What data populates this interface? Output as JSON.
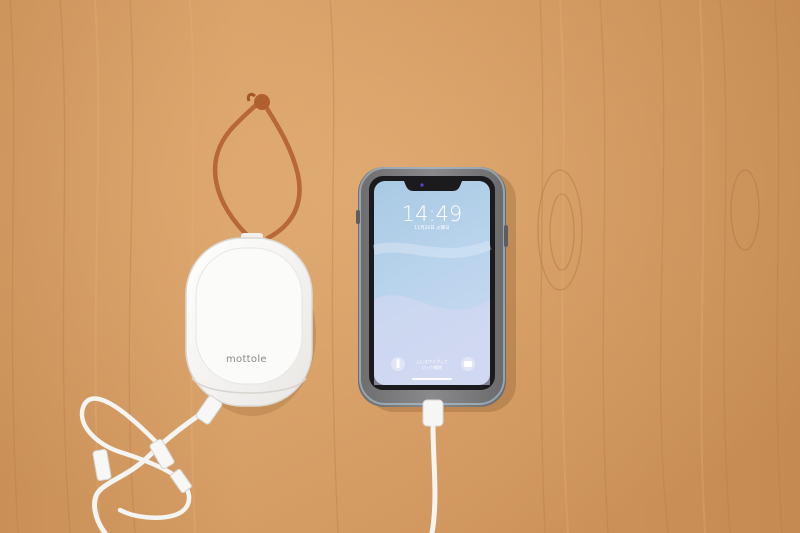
{
  "photo": {
    "battery_brand": "mottole",
    "phone_clock": "14:49",
    "phone_date": "11月20日 火曜日",
    "phone_unlock_hint_line1": "上にスワイプして",
    "phone_unlock_hint_line2": "ロック解除"
  }
}
